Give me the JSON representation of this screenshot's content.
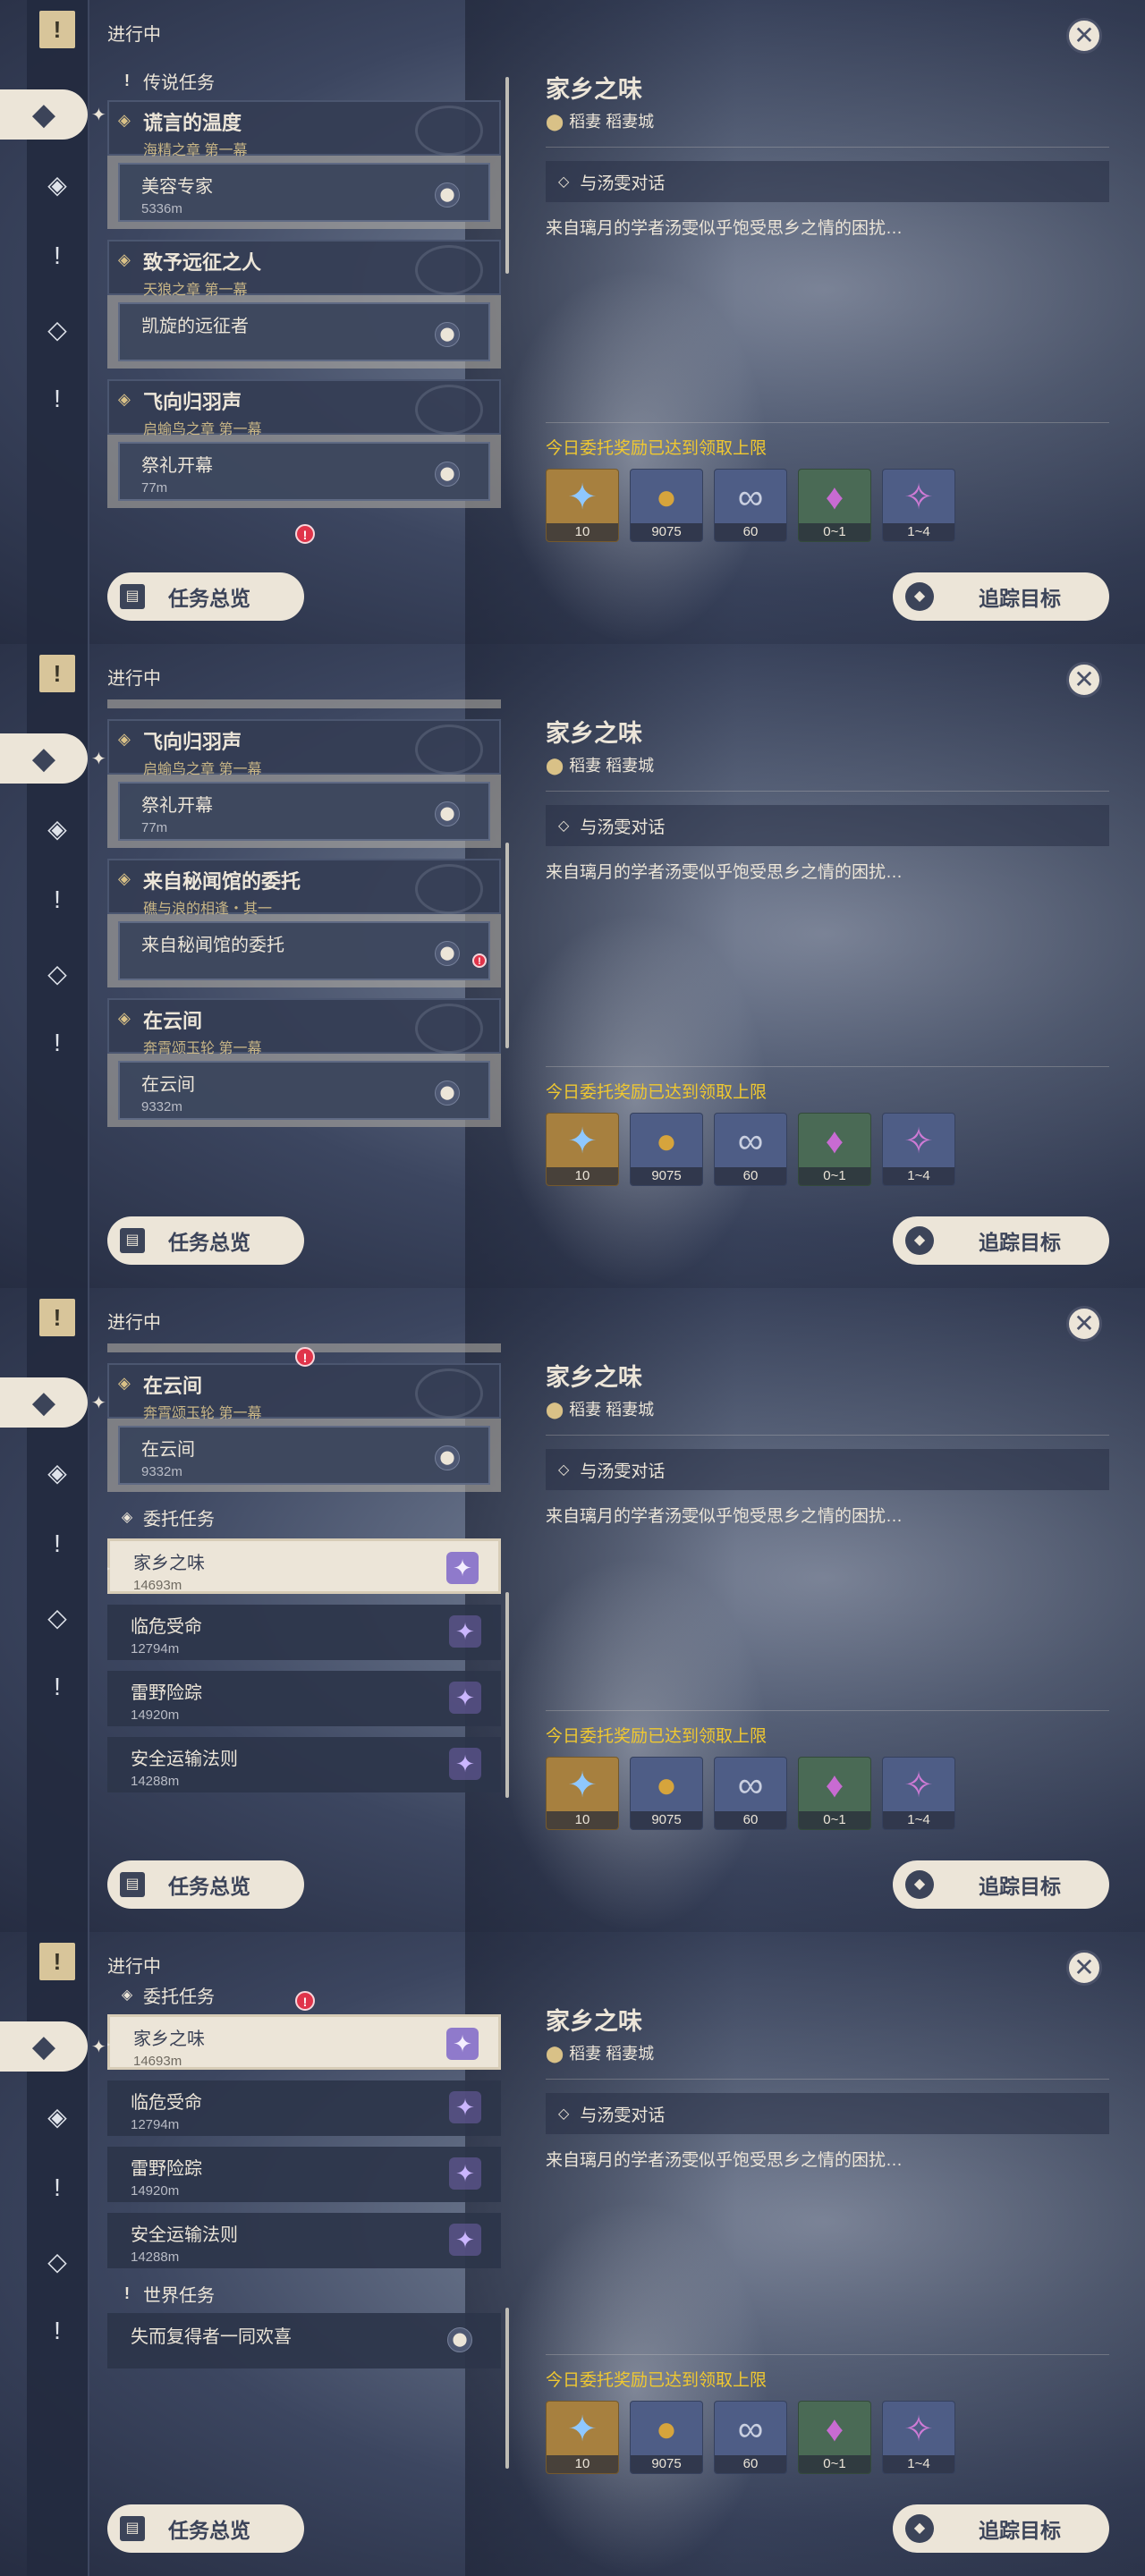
{
  "sidebar": {
    "icons": [
      "pinned-quest-icon",
      "commission-diamond-icon",
      "archon-quest-icon",
      "story-quest-icon",
      "world-diamond-icon",
      "world-quest-icon"
    ],
    "top_glyph": "!",
    "sel_glyph": "◆",
    "icon_glyphs": [
      "◈",
      "!",
      "◇",
      "!"
    ]
  },
  "header": {
    "in_progress": "进行中"
  },
  "close_glyph": "✕",
  "legend_section": "传说任务",
  "commission_section": "委托任务",
  "world_section": "世界任务",
  "groups": {
    "g1": {
      "title": "谎言的温度",
      "subtitle": "海精之章 第一幕",
      "sub": {
        "title": "美容专家",
        "distance": "5336m"
      }
    },
    "g2": {
      "title": "致予远征之人",
      "subtitle": "天狼之章 第一幕",
      "sub": {
        "title": "凯旋的远征者",
        "distance": ""
      }
    },
    "g3": {
      "title": "飞向归羽声",
      "subtitle": "启蝓鸟之章 第一幕",
      "sub": {
        "title": "祭礼开幕",
        "distance": "77m"
      }
    },
    "g4": {
      "title": "来自秘闻馆的委托",
      "subtitle": "礁与浪的相逢・其一",
      "sub": {
        "title": "来自秘闻馆的委托",
        "distance": ""
      }
    },
    "g5": {
      "title": "在云间",
      "subtitle": "奔霄颂玉轮 第一幕",
      "sub": {
        "title": "在云间",
        "distance": "9332m"
      }
    }
  },
  "commissions": [
    {
      "title": "家乡之味",
      "distance": "14693m"
    },
    {
      "title": "临危受命",
      "distance": "12794m"
    },
    {
      "title": "雷野险踪",
      "distance": "14920m"
    },
    {
      "title": "安全运输法则",
      "distance": "14288m"
    }
  ],
  "world_quests": [
    {
      "title": "失而复得者一同欢喜"
    }
  ],
  "buttons": {
    "overview": "任务总览",
    "track": "追踪目标"
  },
  "detail": {
    "title": "家乡之味",
    "location": "稻妻 稻妻城",
    "objective": "与汤雯对话",
    "description": "来自璃月的学者汤雯似乎饱受思乡之情的困扰…",
    "limit_notice": "今日委托奖励已达到领取上限",
    "rewards": [
      {
        "icon": "adventure-exp-icon",
        "amount": "10",
        "bg": "#a7803f",
        "glyph": "✦",
        "color": "#8fc8ff"
      },
      {
        "icon": "mora-icon",
        "amount": "9075",
        "bg": "#4e5d86",
        "glyph": "●",
        "color": "#d6a43c"
      },
      {
        "icon": "companionship-exp-icon",
        "amount": "60",
        "bg": "#4e5d86",
        "glyph": "∞",
        "color": "#c9cfe0"
      },
      {
        "icon": "crystal-chunk-icon",
        "amount": "0~1",
        "bg": "#4a6a55",
        "glyph": "♦",
        "color": "#c86bd2"
      },
      {
        "icon": "crystal-shard-icon",
        "amount": "1~4",
        "bg": "#4e5d86",
        "glyph": "✧",
        "color": "#d07bd6"
      }
    ]
  },
  "alert_glyph": "!"
}
